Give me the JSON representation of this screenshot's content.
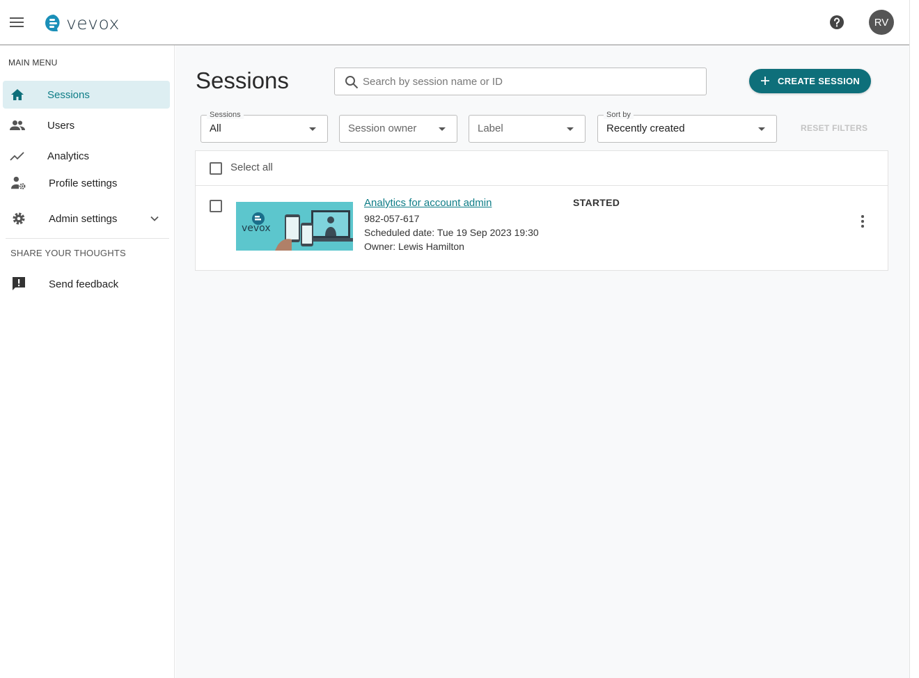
{
  "app": {
    "logo_text": "vevox",
    "avatar_initials": "RV",
    "brand_color": "#0e6f7a"
  },
  "sidebar": {
    "menu_heading": "MAIN MENU",
    "items": [
      {
        "label": "Sessions",
        "icon": "home-icon",
        "active": true
      },
      {
        "label": "Users",
        "icon": "users-icon"
      },
      {
        "label": "Analytics",
        "icon": "analytics-icon"
      },
      {
        "label": "Profile settings",
        "icon": "profile-settings-icon"
      },
      {
        "label": "Admin settings",
        "icon": "gear-icon",
        "expandable": true
      }
    ],
    "share_heading": "SHARE YOUR THOUGHTS",
    "feedback_label": "Send feedback"
  },
  "main": {
    "title": "Sessions",
    "search_placeholder": "Search by session name or ID",
    "create_button": "CREATE SESSION",
    "filters": {
      "sessions": {
        "label": "Sessions",
        "value": "All"
      },
      "owner": {
        "placeholder": "Session owner"
      },
      "label": {
        "placeholder": "Label"
      },
      "sort": {
        "label": "Sort by",
        "value": "Recently created"
      }
    },
    "reset_filters": "RESET FILTERS",
    "select_all": "Select all",
    "sessions": [
      {
        "name": "Analytics for account admin",
        "id": "982-057-617",
        "scheduled": "Scheduled date: Tue 19 Sep 2023 19:30",
        "owner": "Owner: Lewis Hamilton",
        "status": "STARTED",
        "thumbnail_logo": "vevox"
      }
    ]
  }
}
